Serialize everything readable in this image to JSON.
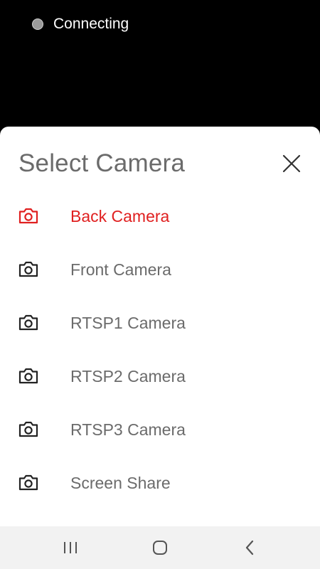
{
  "status": {
    "text": "Connecting"
  },
  "sheet": {
    "title": "Select Camera",
    "selected_color": "#e02020",
    "default_color": "#6b6b6b",
    "items": [
      {
        "label": "Back Camera",
        "icon": "camera-icon",
        "selected": true
      },
      {
        "label": "Front Camera",
        "icon": "camera-icon",
        "selected": false
      },
      {
        "label": "RTSP1 Camera",
        "icon": "camera-icon",
        "selected": false
      },
      {
        "label": "RTSP2 Camera",
        "icon": "camera-icon",
        "selected": false
      },
      {
        "label": "RTSP3 Camera",
        "icon": "camera-icon",
        "selected": false
      },
      {
        "label": "Screen Share",
        "icon": "camera-icon",
        "selected": false
      }
    ]
  },
  "nav": {
    "buttons": [
      "recent-apps-icon",
      "home-icon",
      "back-icon"
    ]
  }
}
